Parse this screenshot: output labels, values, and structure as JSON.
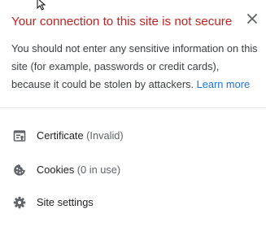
{
  "header": {
    "title": "Your connection to this site is not secure",
    "close_icon": "close-icon"
  },
  "description": {
    "text": "You should not enter any sensitive information on this site (for example, passwords or credit cards), because it could be stolen by attackers. ",
    "link": "Learn more"
  },
  "items": [
    {
      "icon": "certificate-icon",
      "label": "Certificate",
      "detail": "(Invalid)"
    },
    {
      "icon": "cookie-icon",
      "label": "Cookies",
      "detail": "(0 in use)"
    },
    {
      "icon": "gear-icon",
      "label": "Site settings"
    }
  ],
  "colors": {
    "title": "#c5221f",
    "link": "#1a73e8",
    "text": "#3c4043",
    "icon": "#5f6368"
  }
}
